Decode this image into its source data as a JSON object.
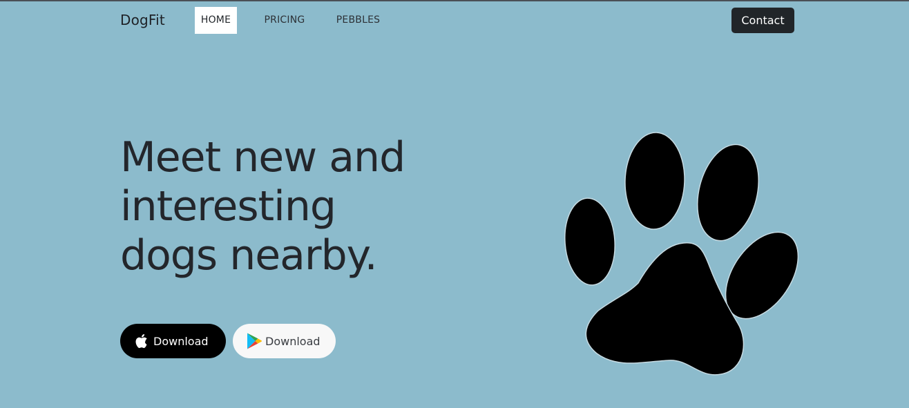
{
  "brand": "DogFit",
  "nav": {
    "items": [
      {
        "label": "HOME",
        "active": true
      },
      {
        "label": "PRICING",
        "active": false
      },
      {
        "label": "PEBBLES",
        "active": false
      }
    ],
    "contact_label": "Contact"
  },
  "hero": {
    "title_lines": [
      "Meet new and",
      "interesting",
      "dogs nearby."
    ],
    "buttons": [
      {
        "label": "Download",
        "icon": "apple-icon"
      },
      {
        "label": "Download",
        "icon": "google-play-icon"
      }
    ],
    "illustration": "paw-print-icon"
  },
  "colors": {
    "background": "#8cbbcc",
    "dark": "#212529",
    "active_nav_bg": "#ffffff",
    "apple_button_bg": "#000000",
    "play_button_bg": "#f8f8f8"
  }
}
